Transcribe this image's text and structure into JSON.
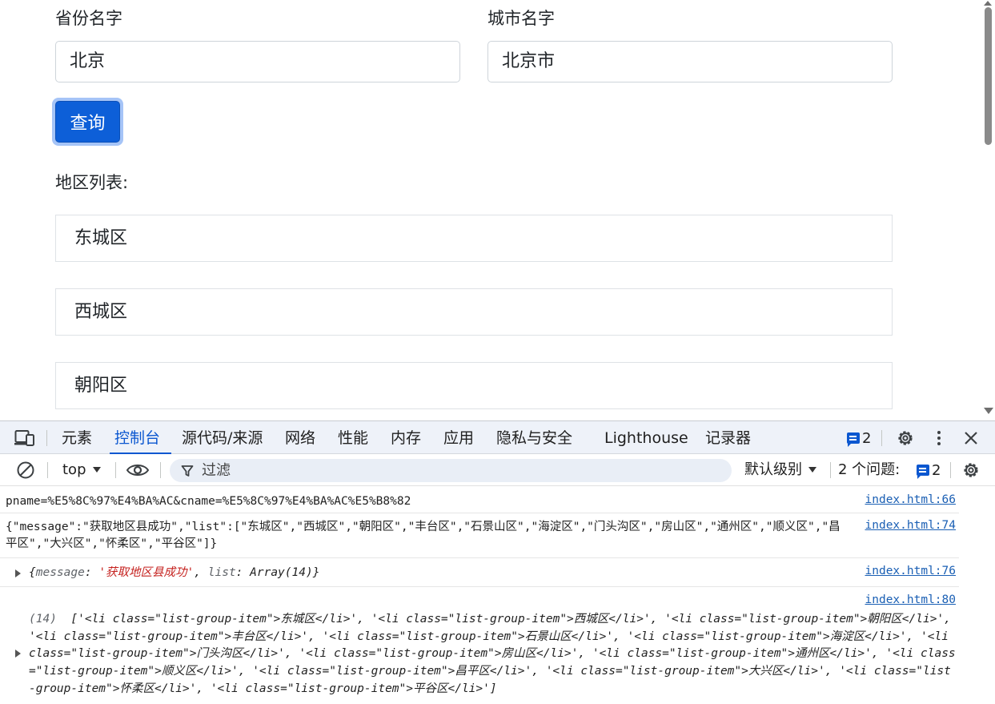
{
  "form": {
    "province_label": "省份名字",
    "province_value": "北京",
    "city_label": "城市名字",
    "city_value": "北京市",
    "query_button": "查询",
    "list_heading": "地区列表:"
  },
  "districts": [
    "东城区",
    "西城区",
    "朝阳区"
  ],
  "devtools": {
    "tabs": [
      "元素",
      "控制台",
      "源代码/来源",
      "网络",
      "性能",
      "内存",
      "应用",
      "隐私与安全",
      "Lighthouse",
      "记录器"
    ],
    "active_tab": "控制台",
    "issue_count": "2",
    "context": "top",
    "filter_placeholder": "过滤",
    "level": "默认级别",
    "issues_label": "2 个问题:",
    "issues_count": "2"
  },
  "console": {
    "line1_text": "pname=%E5%8C%97%E4%BA%AC&cname=%E5%8C%97%E4%BA%AC%E5%B8%82",
    "line1_src": "index.html:66",
    "line2_text": "{\"message\":\"获取地区县成功\",\"list\":[\"东城区\",\"西城区\",\"朝阳区\",\"丰台区\",\"石景山区\",\"海淀区\",\"门头沟区\",\"房山区\",\"通州区\",\"顺义区\",\"昌平区\",\"大兴区\",\"怀柔区\",\"平谷区\"]}",
    "line2_src": "index.html:74",
    "line3_key1": "message",
    "line3_val1": "'获取地区县成功'",
    "line3_key2": "list",
    "line3_val2": "Array(14)",
    "line3_src": "index.html:76",
    "line4_count": "(14)",
    "line4_text": "['<li class=\"list-group-item\">东城区</li>', '<li class=\"list-group-item\">西城区</li>', '<li class=\"list-group-item\">朝阳区</li>', '<li class=\"list-group-item\">丰台区</li>', '<li class=\"list-group-item\">石景山区</li>', '<li class=\"list-group-item\">海淀区</li>', '<li class=\"list-group-item\">门头沟区</li>', '<li class=\"list-group-item\">房山区</li>', '<li class=\"list-group-item\">通州区</li>', '<li class=\"list-group-item\">顺义区</li>', '<li class=\"list-group-item\">昌平区</li>', '<li class=\"list-group-item\">大兴区</li>', '<li class=\"list-group-item\">怀柔区</li>', '<li class=\"list-group-item\">平谷区</li>']",
    "line4_src": "index.html:80"
  },
  "colors": {
    "primary": "#0d5fd8",
    "devtools_accent": "#0b57d0",
    "string_red": "#c5221f"
  }
}
